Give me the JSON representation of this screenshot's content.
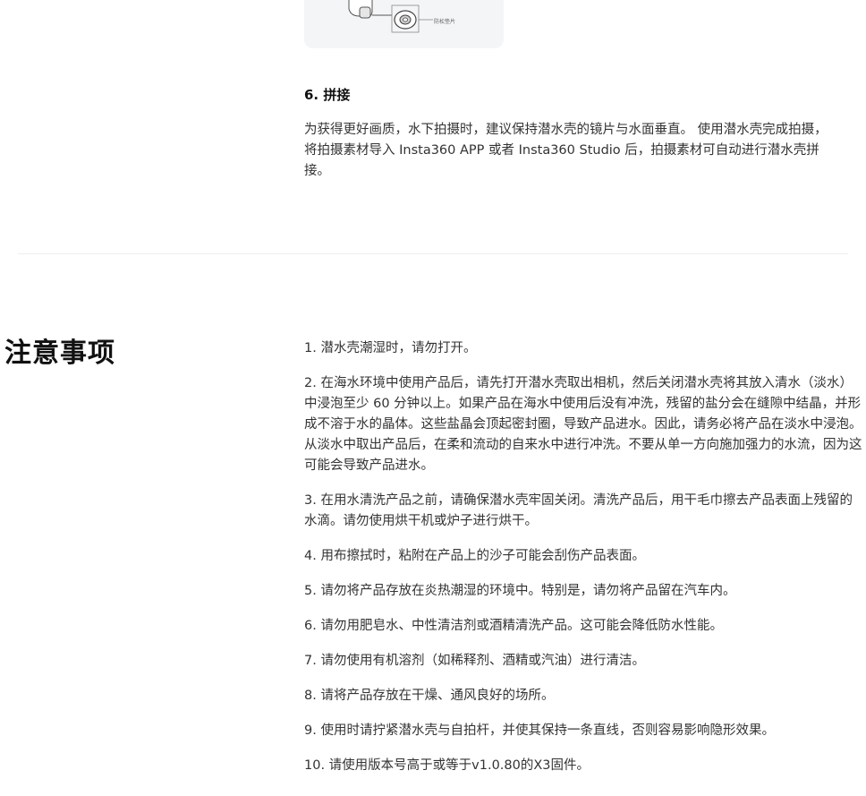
{
  "figure": {
    "label": "防松垫片"
  },
  "step": {
    "title": "6. 拼接",
    "body": "为获得更好画质，水下拍摄时，建议保持潜水壳的镜片与水面垂直。 使用潜水壳完成拍摄，将拍摄素材导入 Insta360 APP 或者 Insta360 Studio 后，拍摄素材可自动进行潜水壳拼接。"
  },
  "precautions": {
    "title": "注意事项",
    "items": [
      "1. 潜水壳潮湿时，请勿打开。",
      "2. 在海水环境中使用产品后，请先打开潜水壳取出相机，然后关闭潜水壳将其放入清水（淡水）中浸泡至少 60 分钟以上。如果产品在海水中使用后没有冲洗，残留的盐分会在缝隙中结晶，并形成不溶于水的晶体。这些盐晶会顶起密封圈，导致产品进水。因此，请务必将产品在淡水中浸泡。从淡水中取出产品后，在柔和流动的自来水中进行冲洗。不要从单一方向施加强力的水流，因为这可能会导致产品进水。",
      "3. 在用水清洗产品之前，请确保潜水壳牢固关闭。清洗产品后，用干毛巾擦去产品表面上残留的水滴。请勿使用烘干机或炉子进行烘干。",
      "4. 用布擦拭时，粘附在产品上的沙子可能会刮伤产品表面。",
      "5. 请勿将产品存放在炎热潮湿的环境中。特别是，请勿将产品留在汽车内。",
      "6. 请勿用肥皂水、中性清洁剂或酒精清洗产品。这可能会降低防水性能。",
      "7. 请勿使用有机溶剂（如稀释剂、酒精或汽油）进行清洁。",
      "8. 请将产品存放在干燥、通风良好的场所。",
      "9. 使用时请拧紧潜水壳与自拍杆，并使其保持一条直线，否则容易影响隐形效果。",
      "10. 请使用版本号高于或等于v1.0.80的X3固件。"
    ]
  }
}
